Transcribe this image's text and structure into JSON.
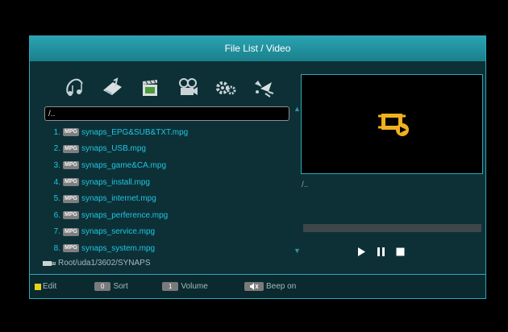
{
  "window": {
    "title": "File List / Video"
  },
  "categories": [
    {
      "icon": "music-icon"
    },
    {
      "icon": "picture-icon"
    },
    {
      "icon": "video-icon"
    },
    {
      "icon": "camera-icon"
    },
    {
      "icon": "settings-icon"
    },
    {
      "icon": "plugin-icon"
    }
  ],
  "path_field": "/..",
  "files": [
    {
      "num": "1.",
      "badge": "MPG",
      "name": "synaps_EPG&SUB&TXT.mpg"
    },
    {
      "num": "2.",
      "badge": "MPG",
      "name": "synaps_USB.mpg"
    },
    {
      "num": "3.",
      "badge": "MPG",
      "name": "synaps_game&CA.mpg"
    },
    {
      "num": "4.",
      "badge": "MPG",
      "name": "synaps_install.mpg"
    },
    {
      "num": "5.",
      "badge": "MPG",
      "name": "synaps_internet.mpg"
    },
    {
      "num": "6.",
      "badge": "MPG",
      "name": "synaps_perference.mpg"
    },
    {
      "num": "7.",
      "badge": "MPG",
      "name": "synaps_service.mpg"
    },
    {
      "num": "8.",
      "badge": "MPG",
      "name": "synaps_system.mpg"
    }
  ],
  "current_path": "Root/uda1/3602/SYNAPS",
  "preview": {
    "path": "/..",
    "progress": 0
  },
  "hints": {
    "edit": "Edit",
    "sort_key": "0",
    "sort": "Sort",
    "volume_key": "1",
    "volume": "Volume",
    "beep": "Beep on"
  },
  "colors": {
    "accent": "#2ea7b8",
    "list_text": "#1fc6e0",
    "icon_yellow": "#f0b020"
  }
}
